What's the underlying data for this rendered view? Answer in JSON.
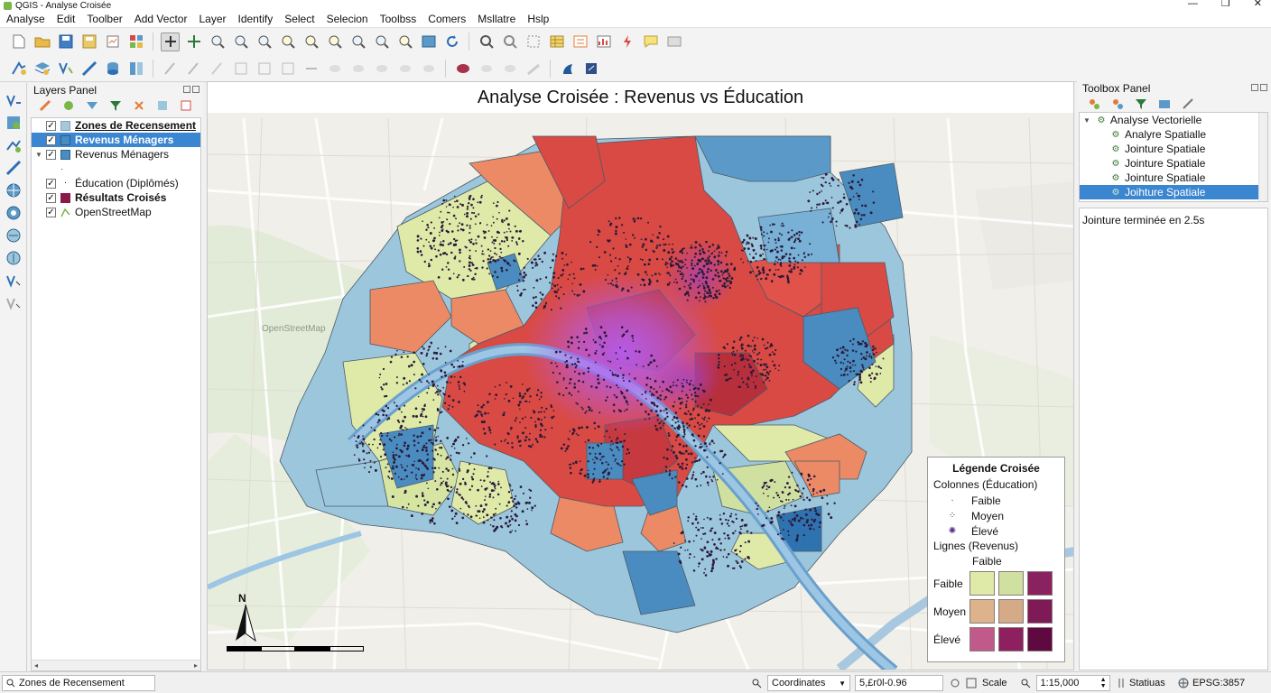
{
  "window": {
    "title": "QGIS - Analyse Croisée",
    "controls": [
      "—",
      "❐",
      "✕"
    ]
  },
  "menu": [
    "Analyse",
    "Edit",
    "Toolber",
    "Add Vector",
    "Layer",
    "Identify",
    "Select",
    "Selecion",
    "Toolbss",
    "Comers",
    "Msllatre",
    "Hslp"
  ],
  "layers_panel": {
    "title": "Layers Panel",
    "layers": [
      {
        "label": "Zones de Recensement",
        "checked": true,
        "symbol_color": "#a8c8d8",
        "style": "bold underline"
      },
      {
        "label": "Revenus Ménagers",
        "checked": true,
        "symbol_color": "#4a8cc0",
        "style": "selected"
      },
      {
        "label": "Revenus Ménagers",
        "checked": true,
        "symbol_color": "#4a8cc0",
        "style": "expanded"
      },
      {
        "label": "",
        "checked": false,
        "symbol": "dot-small"
      },
      {
        "label": "Éducation (Diplômés)",
        "checked": true,
        "symbol": "dot"
      },
      {
        "label": "Résultats Croisés",
        "checked": true,
        "symbol_color": "#8b1a4a",
        "style": "bold"
      },
      {
        "label": "OpenStreetMap",
        "checked": true,
        "symbol": "osm"
      }
    ]
  },
  "map": {
    "title": "Analyse Croisée : Revenus vs Éducation",
    "north_label": "N",
    "basemap_labels": [
      "OpenStreetMap"
    ]
  },
  "legend": {
    "title": "Légende Croisée",
    "columns_label": "Colonnes (Éducation)",
    "columns": [
      {
        "label": "Faible",
        "marker": "·"
      },
      {
        "label": "Moyen",
        "marker": "⁘"
      },
      {
        "label": "Élevé",
        "marker": "✺"
      }
    ],
    "rows_label": "Lignes (Revenus)",
    "column_header": "Faible",
    "matrix": [
      {
        "label": "Faible",
        "colors": [
          "#dfeaa8",
          "#cfe0a0",
          "#8b2260"
        ]
      },
      {
        "label": "Moyen",
        "colors": [
          "#dcb38a",
          "#d4ab86",
          "#7e1a55"
        ]
      },
      {
        "label": "Élevé",
        "colors": [
          "#c05a8a",
          "#8e2060",
          "#5e0a40"
        ]
      }
    ]
  },
  "toolbox_panel": {
    "title": "Toolbox Panel",
    "group": "Analyse Vectorielle",
    "tools": [
      "Analyre Spatialle",
      "Jointure Spatiale",
      "Jointure Spatiale",
      "Jointure Spatiale",
      "Joihture Spatiale"
    ],
    "log": "Jointure terminée en 2.5s"
  },
  "statusbar": {
    "locator": "Zones de Recensement",
    "coordinates_label": "Coordinates",
    "coordinates_value": "5,£r0l-0.96",
    "scale_label": "Scale",
    "scale_value": "1:15,000",
    "status_label": "Statiuas",
    "crs": "EPSG:3857"
  },
  "colors": {
    "selection": "#3b86d0",
    "red": "#d94a44",
    "blue": "#5b9ac8",
    "light_blue": "#9cc6dc",
    "yellow_green": "#dfeaa8",
    "purple_hotspot": "#b45cf0"
  }
}
